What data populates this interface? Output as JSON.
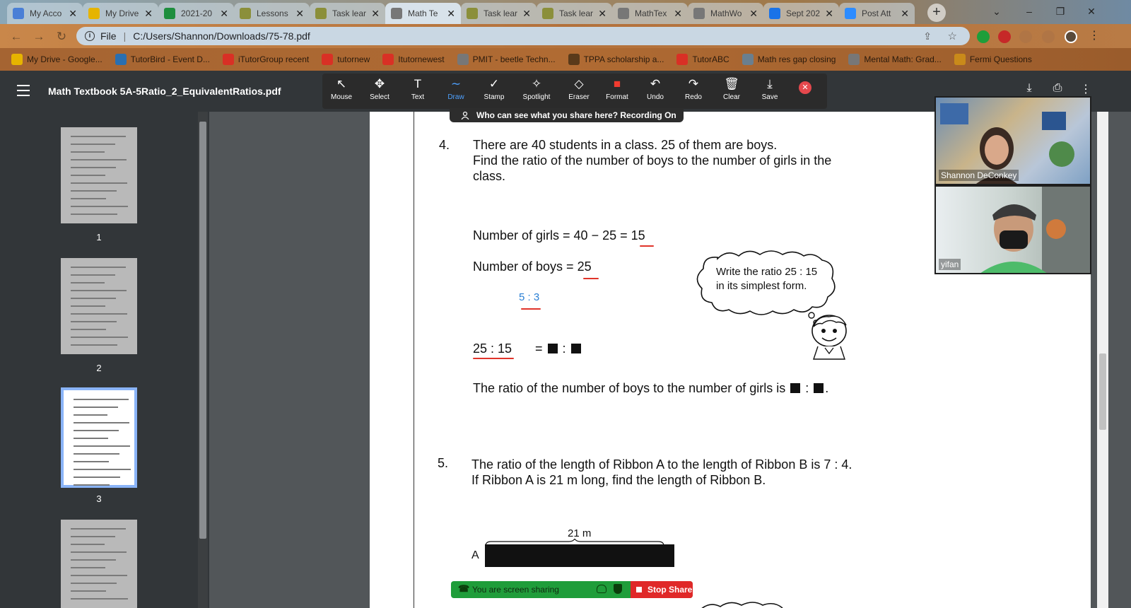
{
  "browser": {
    "tabs": [
      {
        "label": "My Acco",
        "color": "#4a7fd6"
      },
      {
        "label": "My Drive",
        "color": "#e6b400"
      },
      {
        "label": "2021-20",
        "color": "#1e8e3e"
      },
      {
        "label": "Lessons",
        "color": "#8b8f3a"
      },
      {
        "label": "Task lear",
        "color": "#8b8f3a"
      },
      {
        "label": "Math Te",
        "color": "#777777"
      },
      {
        "label": "Task lear",
        "color": "#8b8f3a"
      },
      {
        "label": "Task lear",
        "color": "#8b8f3a"
      },
      {
        "label": "MathTex",
        "color": "#777777"
      },
      {
        "label": "MathWo",
        "color": "#777777"
      },
      {
        "label": "Sept 202",
        "color": "#1a73e8"
      },
      {
        "label": "Post Att",
        "color": "#2d8cff"
      }
    ],
    "address": {
      "scheme": "File",
      "url": "C:/Users/Shannon/Downloads/75-78.pdf"
    },
    "bookmarks": [
      {
        "label": "My Drive - Google...",
        "color": "#e6b400"
      },
      {
        "label": "TutorBird - Event D...",
        "color": "#2a6fb0"
      },
      {
        "label": "iTutorGroup recent",
        "color": "#d93025"
      },
      {
        "label": "tutornew",
        "color": "#d93025"
      },
      {
        "label": "Itutornewest",
        "color": "#d93025"
      },
      {
        "label": "PMIT - beetle Techn...",
        "color": "#777777"
      },
      {
        "label": "TPPA scholarship a...",
        "color": "#5a3a1a"
      },
      {
        "label": "TutorABC",
        "color": "#d93025"
      },
      {
        "label": "Math res gap closing",
        "color": "#6a7f8f"
      },
      {
        "label": "Mental Math: Grad...",
        "color": "#777777"
      },
      {
        "label": "Fermi Questions",
        "color": "#c98a1a"
      }
    ]
  },
  "viewer": {
    "title": "Math Textbook 5A-5Ratio_2_EquivalentRatios.pdf",
    "tools": [
      {
        "label": "Mouse",
        "icon": "↖"
      },
      {
        "label": "Select",
        "icon": "✥"
      },
      {
        "label": "Text",
        "icon": "T"
      },
      {
        "label": "Draw",
        "icon": "∼"
      },
      {
        "label": "Stamp",
        "icon": "✓"
      },
      {
        "label": "Spotlight",
        "icon": "✧"
      },
      {
        "label": "Eraser",
        "icon": "◇"
      },
      {
        "label": "Format",
        "icon": "■"
      },
      {
        "label": "Undo",
        "icon": "↶"
      },
      {
        "label": "Redo",
        "icon": "↷"
      },
      {
        "label": "Clear",
        "icon": "🗑"
      },
      {
        "label": "Save",
        "icon": "⤓"
      }
    ],
    "notice": "Who can see what you share here? Recording On",
    "pages": [
      "1",
      "2",
      "3"
    ]
  },
  "document": {
    "q4": {
      "number": "4.",
      "line1": "There are 40 students in a class. 25 of them are boys.",
      "line2": "Find the ratio of the number of boys to the number of girls in the",
      "line3": "class.",
      "girls": "Number of girls = 40 − 25 = 15",
      "boys": "Number of boys = 25",
      "handwritten": "5 : 3",
      "bubble1": "Write the ratio 25 : 15",
      "bubble2": "in its simplest form.",
      "ratio_left": "25 : 15",
      "ratio_right": "=",
      "ratio_sep": ":",
      "answer": "The ratio of the number of boys to the number of girls is"
    },
    "q5": {
      "number": "5.",
      "line1": "The ratio of the length of Ribbon A to the length of Ribbon B is 7 : 4.",
      "line2": "If Ribbon A is 21 m long, find the length of Ribbon B.",
      "ribbon_label": "21 m",
      "ribbon_a": "A"
    }
  },
  "zoom": {
    "participants": [
      {
        "name": "Shannon DeConkey"
      },
      {
        "name": "yifan"
      }
    ],
    "share_status": "You are screen sharing",
    "stop_share": "Stop Share"
  }
}
